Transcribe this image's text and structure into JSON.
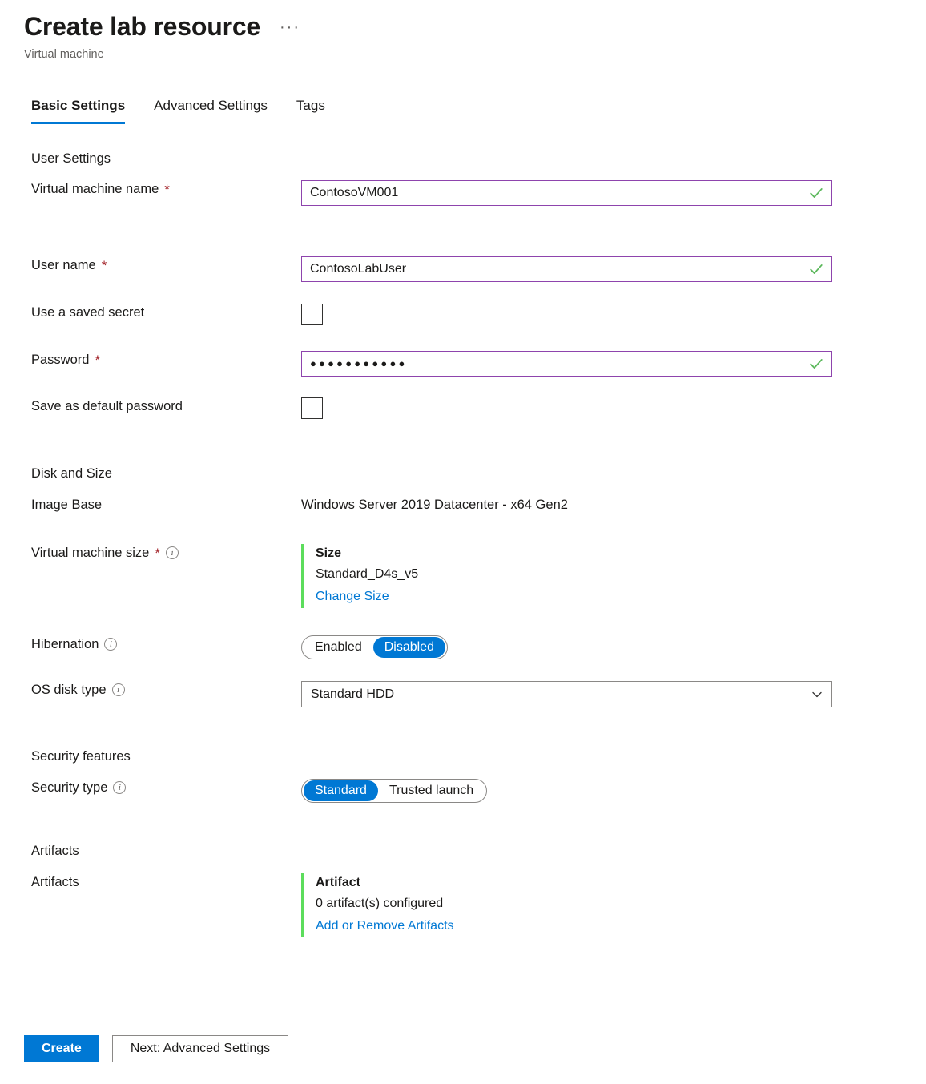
{
  "header": {
    "title": "Create lab resource",
    "subtitle": "Virtual machine",
    "more_actions": "···"
  },
  "tabs": [
    {
      "label": "Basic Settings",
      "active": true
    },
    {
      "label": "Advanced Settings",
      "active": false
    },
    {
      "label": "Tags",
      "active": false
    }
  ],
  "sections": {
    "user_settings": {
      "title": "User Settings",
      "vm_name": {
        "label": "Virtual machine name",
        "required": "*",
        "value": "ContosoVM001",
        "valid": true
      },
      "user_name": {
        "label": "User name",
        "required": "*",
        "value": "ContosoLabUser",
        "valid": true
      },
      "saved_secret": {
        "label": "Use a saved secret",
        "checked": false
      },
      "password": {
        "label": "Password",
        "required": "*",
        "value": "●●●●●●●●●●●",
        "valid": true
      },
      "default_password": {
        "label": "Save as default password",
        "checked": false
      }
    },
    "disk_and_size": {
      "title": "Disk and Size",
      "image_base": {
        "label": "Image Base",
        "value": "Windows Server 2019 Datacenter - x64 Gen2"
      },
      "vm_size": {
        "label": "Virtual machine size",
        "required": "*",
        "box_title": "Size",
        "box_value": "Standard_D4s_v5",
        "box_link": "Change Size"
      },
      "hibernation": {
        "label": "Hibernation",
        "options": [
          "Enabled",
          "Disabled"
        ],
        "selected": "Disabled"
      },
      "os_disk_type": {
        "label": "OS disk type",
        "value": "Standard HDD"
      }
    },
    "security_features": {
      "title": "Security features",
      "security_type": {
        "label": "Security type",
        "options": [
          "Standard",
          "Trusted launch"
        ],
        "selected": "Standard"
      }
    },
    "artifacts": {
      "title": "Artifacts",
      "label": "Artifacts",
      "box_title": "Artifact",
      "box_value": "0 artifact(s) configured",
      "box_link": "Add or Remove Artifacts"
    }
  },
  "footer": {
    "create_label": "Create",
    "next_label": "Next: Advanced Settings"
  },
  "colors": {
    "accent_blue": "#0078d4",
    "valid_green": "#5cb85c",
    "accent_bar_green": "#5cdd5c",
    "required_red": "#a4262c",
    "input_border": "#8e44ad"
  }
}
